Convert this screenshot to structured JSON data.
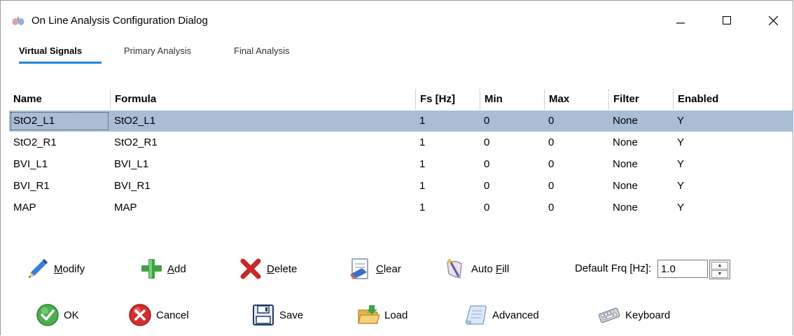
{
  "window": {
    "title": "On Line Analysis Configuration Dialog",
    "icon": "lungs-icon",
    "controls": {
      "minimize": "minimize-icon",
      "maximize": "maximize-icon",
      "close": "close-icon"
    }
  },
  "tabs": [
    {
      "label": "Virtual Signals",
      "active": true
    },
    {
      "label": "Primary Analysis",
      "active": false
    },
    {
      "label": "Final Analysis",
      "active": false
    }
  ],
  "grid": {
    "columns": [
      "Name",
      "Formula",
      "Fs [Hz]",
      "Min",
      "Max",
      "Filter",
      "Enabled"
    ],
    "rows": [
      [
        "StO2_L1",
        "StO2_L1",
        "1",
        "0",
        "0",
        "None",
        "Y"
      ],
      [
        "StO2_R1",
        "StO2_R1",
        "1",
        "0",
        "0",
        "None",
        "Y"
      ],
      [
        "BVI_L1",
        "BVI_L1",
        "1",
        "0",
        "0",
        "None",
        "Y"
      ],
      [
        "BVI_R1",
        "BVI_R1",
        "1",
        "0",
        "0",
        "None",
        "Y"
      ],
      [
        "MAP",
        "MAP",
        "1",
        "0",
        "0",
        "None",
        "Y"
      ]
    ],
    "selected_row": 0,
    "selection_color": "#a9bdd5"
  },
  "actions": {
    "modify": {
      "pre": "",
      "key": "M",
      "post": "odify",
      "icon": "pencil-icon"
    },
    "add": {
      "pre": "",
      "key": "A",
      "post": "dd",
      "icon": "plus-icon"
    },
    "delete": {
      "pre": "",
      "key": "D",
      "post": "elete",
      "icon": "x-icon"
    },
    "clear": {
      "pre": "",
      "key": "C",
      "post": "lear",
      "icon": "eraser-icon"
    },
    "autofill": {
      "pre": "Auto ",
      "key": "F",
      "post": "ill",
      "icon": "wand-icon"
    }
  },
  "default_frq": {
    "label": "Default Frq [Hz]:",
    "value": "1.0"
  },
  "footer": {
    "ok": {
      "label": "OK",
      "icon": "check-circle-icon"
    },
    "cancel": {
      "label": "Cancel",
      "icon": "cancel-circle-icon"
    },
    "save": {
      "label": "Save",
      "icon": "floppy-icon"
    },
    "load": {
      "label": "Load",
      "icon": "folder-icon"
    },
    "advanced": {
      "label": "Advanced",
      "icon": "scroll-icon"
    },
    "keyboard": {
      "label": "Keyboard",
      "icon": "keyboard-icon"
    }
  },
  "colors": {
    "accent": "#1e88d3",
    "ok_green": "#4caf50",
    "cancel_red": "#d32f2f",
    "delete_red": "#c62828",
    "add_green": "#43a047"
  }
}
